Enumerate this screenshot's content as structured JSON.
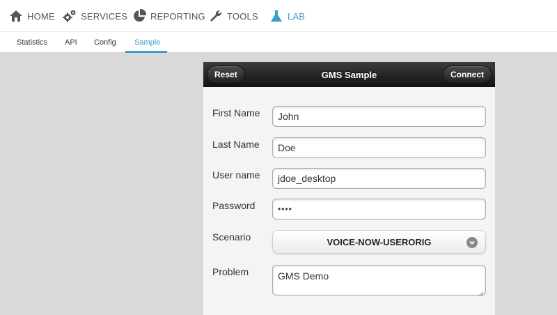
{
  "topnav": {
    "items": [
      {
        "label": "HOME",
        "icon": "home-icon"
      },
      {
        "label": "SERVICES",
        "icon": "gears-icon"
      },
      {
        "label": "REPORTING",
        "icon": "pie-chart-icon"
      },
      {
        "label": "TOOLS",
        "icon": "wrench-icon"
      },
      {
        "label": "LAB",
        "icon": "flask-icon",
        "active": true
      }
    ]
  },
  "subnav": {
    "items": [
      {
        "label": "Statistics"
      },
      {
        "label": "API"
      },
      {
        "label": "Config"
      },
      {
        "label": "Sample",
        "active": true
      }
    ]
  },
  "panel": {
    "title": "GMS Sample",
    "reset_label": "Reset",
    "connect_label": "Connect",
    "fields": {
      "first_name": {
        "label": "First Name",
        "value": "John"
      },
      "last_name": {
        "label": "Last Name",
        "value": "Doe"
      },
      "user_name": {
        "label": "User name",
        "value": "jdoe_desktop"
      },
      "password": {
        "label": "Password",
        "value": "••••"
      },
      "scenario": {
        "label": "Scenario",
        "value": "VOICE-NOW-USERORIG"
      },
      "problem": {
        "label": "Problem",
        "value": "GMS Demo"
      }
    }
  },
  "colors": {
    "accent": "#3b9cc7",
    "header_dark": "#1a1a1a",
    "background": "#d9d9d9"
  }
}
